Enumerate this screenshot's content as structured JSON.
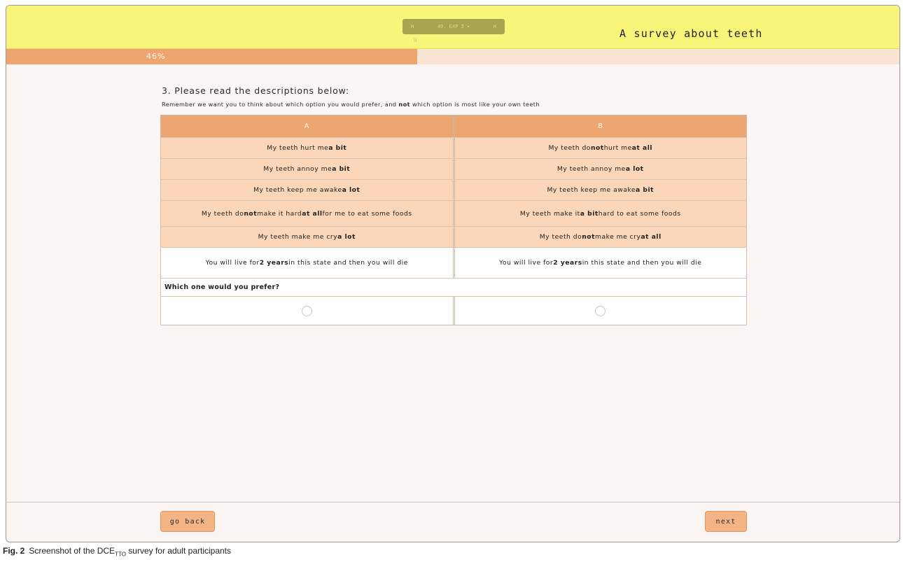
{
  "header": {
    "nav_left": "H",
    "nav_center": "49. EXP 3 ▾",
    "nav_right": "H",
    "nav_sub": "H",
    "title": "A survey about teeth"
  },
  "progress": {
    "label": "46%",
    "value": 0.46
  },
  "question": {
    "title": "3. Please read the descriptions below:",
    "note_pre": "Remember we want you to think about which option you would prefer, and ",
    "note_bold": "not",
    "note_post": " which option is most like your own teeth"
  },
  "options": {
    "a_header": "A",
    "b_header": "B",
    "rows": [
      {
        "a": [
          {
            "t": "My teeth hurt me ",
            "b": false
          },
          {
            "t": "a bit",
            "b": true
          }
        ],
        "b": [
          {
            "t": "My teeth do ",
            "b": false
          },
          {
            "t": "not",
            "b": true
          },
          {
            "t": " hurt me ",
            "b": false
          },
          {
            "t": "at all",
            "b": true
          }
        ]
      },
      {
        "a": [
          {
            "t": "My teeth annoy me ",
            "b": false
          },
          {
            "t": "a bit",
            "b": true
          }
        ],
        "b": [
          {
            "t": "My teeth annoy me ",
            "b": false
          },
          {
            "t": "a lot",
            "b": true
          }
        ]
      },
      {
        "a": [
          {
            "t": "My teeth keep me awake ",
            "b": false
          },
          {
            "t": "a lot",
            "b": true
          }
        ],
        "b": [
          {
            "t": "My teeth keep me awake ",
            "b": false
          },
          {
            "t": "a bit",
            "b": true
          }
        ]
      },
      {
        "a": [
          {
            "t": "My teeth do ",
            "b": false
          },
          {
            "t": "not",
            "b": true
          },
          {
            "t": " make it hard ",
            "b": false
          },
          {
            "t": "at all",
            "b": true
          },
          {
            "t": " for me to eat some foods",
            "b": false
          }
        ],
        "b": [
          {
            "t": "My teeth make it ",
            "b": false
          },
          {
            "t": "a bit",
            "b": true
          },
          {
            "t": " hard to eat some foods",
            "b": false
          }
        ]
      },
      {
        "a": [
          {
            "t": "My teeth make me cry ",
            "b": false
          },
          {
            "t": "a lot",
            "b": true
          }
        ],
        "b": [
          {
            "t": "My teeth do ",
            "b": false
          },
          {
            "t": "not",
            "b": true
          },
          {
            "t": " make me cry ",
            "b": false
          },
          {
            "t": "at all",
            "b": true
          }
        ]
      }
    ],
    "life": {
      "a": [
        {
          "t": "You will live for ",
          "b": false
        },
        {
          "t": "2 years",
          "b": true
        },
        {
          "t": " in this state and then you will die",
          "b": false
        }
      ],
      "b": [
        {
          "t": "You will live for ",
          "b": false
        },
        {
          "t": "2 years",
          "b": true
        },
        {
          "t": " in this state and then you will die",
          "b": false
        }
      ]
    },
    "prefer_label": "Which one would you prefer?"
  },
  "buttons": {
    "back": "go back",
    "next": "next"
  },
  "caption": {
    "fig": "Fig. 2",
    "pre": "Screenshot of the DCE",
    "sub": "TTO",
    "post": " survey for adult participants"
  },
  "colors": {
    "header_bg": "#f8f57a",
    "accent": "#eda66f",
    "attr_bg": "#fbd6b8",
    "button_bg": "#f4b485"
  }
}
